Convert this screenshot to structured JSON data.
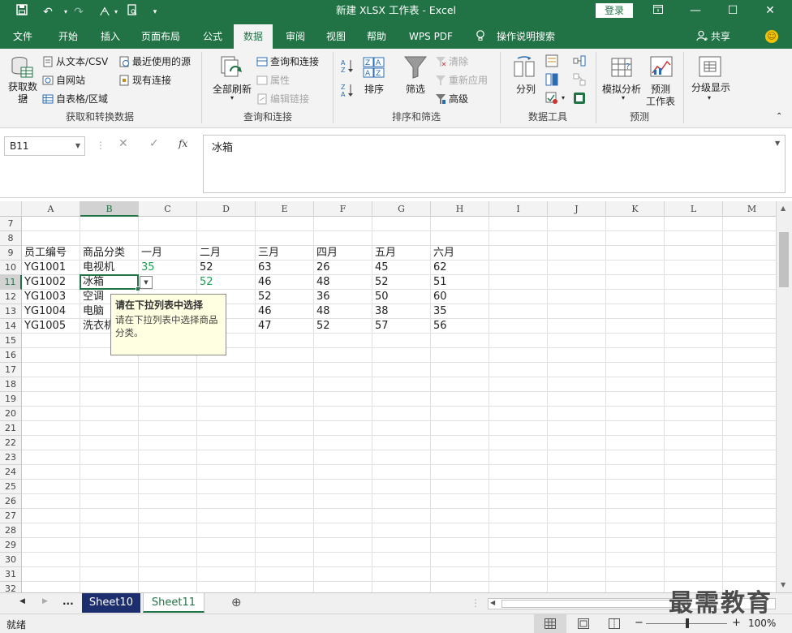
{
  "title": "新建 XLSX 工作表  -  Excel",
  "login": "登录",
  "tabs": [
    "文件",
    "开始",
    "插入",
    "页面布局",
    "公式",
    "数据",
    "审阅",
    "视图",
    "帮助",
    "WPS PDF",
    "操作说明搜索"
  ],
  "active_tab": "数据",
  "share": "共享",
  "ribbon": {
    "get_data": "获取数据",
    "from_text": "从文本/CSV",
    "from_web": "自网站",
    "from_table": "自表格/区域",
    "recent_sources": "最近使用的源",
    "existing_conn": "现有连接",
    "group1": "获取和转换数据",
    "refresh_all": "全部刷新",
    "query_conn": "查询和连接",
    "properties": "属性",
    "edit_links": "编辑链接",
    "group2": "查询和连接",
    "sort": "排序",
    "filter": "筛选",
    "clear": "清除",
    "reapply": "重新应用",
    "advanced": "高级",
    "group3": "排序和筛选",
    "text_to_cols": "分列",
    "group4": "数据工具",
    "what_if": "模拟分析",
    "forecast_sheet": "预测",
    "forecast_sheet2": "工作表",
    "group5": "预测",
    "outline": "分级显示"
  },
  "namebox": "B11",
  "formula": "冰箱",
  "columns": [
    "A",
    "B",
    "C",
    "D",
    "E",
    "F",
    "G",
    "H",
    "I",
    "J",
    "K",
    "L",
    "M"
  ],
  "rows": [
    "7",
    "8",
    "9",
    "10",
    "11",
    "12",
    "13",
    "14",
    "15",
    "16",
    "17",
    "18",
    "19",
    "20",
    "21",
    "22",
    "23",
    "24",
    "25",
    "26",
    "27",
    "28",
    "29",
    "30",
    "31",
    "32"
  ],
  "headers": [
    "员工编号",
    "商品分类",
    "一月",
    "二月",
    "三月",
    "四月",
    "五月",
    "六月"
  ],
  "data": [
    [
      "YG1001",
      "电视机",
      "35",
      "52",
      "63",
      "26",
      "45",
      "62"
    ],
    [
      "YG1002",
      "冰箱",
      "",
      "52",
      "46",
      "48",
      "52",
      "51"
    ],
    [
      "YG1003",
      "空调",
      "",
      "",
      "52",
      "36",
      "50",
      "60"
    ],
    [
      "YG1004",
      "电脑",
      "",
      "",
      "46",
      "48",
      "38",
      "35"
    ],
    [
      "YG1005",
      "洗衣机",
      "",
      "",
      "47",
      "52",
      "57",
      "56"
    ]
  ],
  "tooltip": {
    "title": "请在下拉列表中选择",
    "message": "请在下拉列表中选择商品分类。"
  },
  "sheets": [
    "Sheet10",
    "Sheet11"
  ],
  "active_sheet": "Sheet11",
  "more_sheets": "...",
  "status": "就绪",
  "zoom": "100%",
  "watermark": "最需教育",
  "colors": {
    "brand": "#217346",
    "green_text": "#1e9e52"
  }
}
